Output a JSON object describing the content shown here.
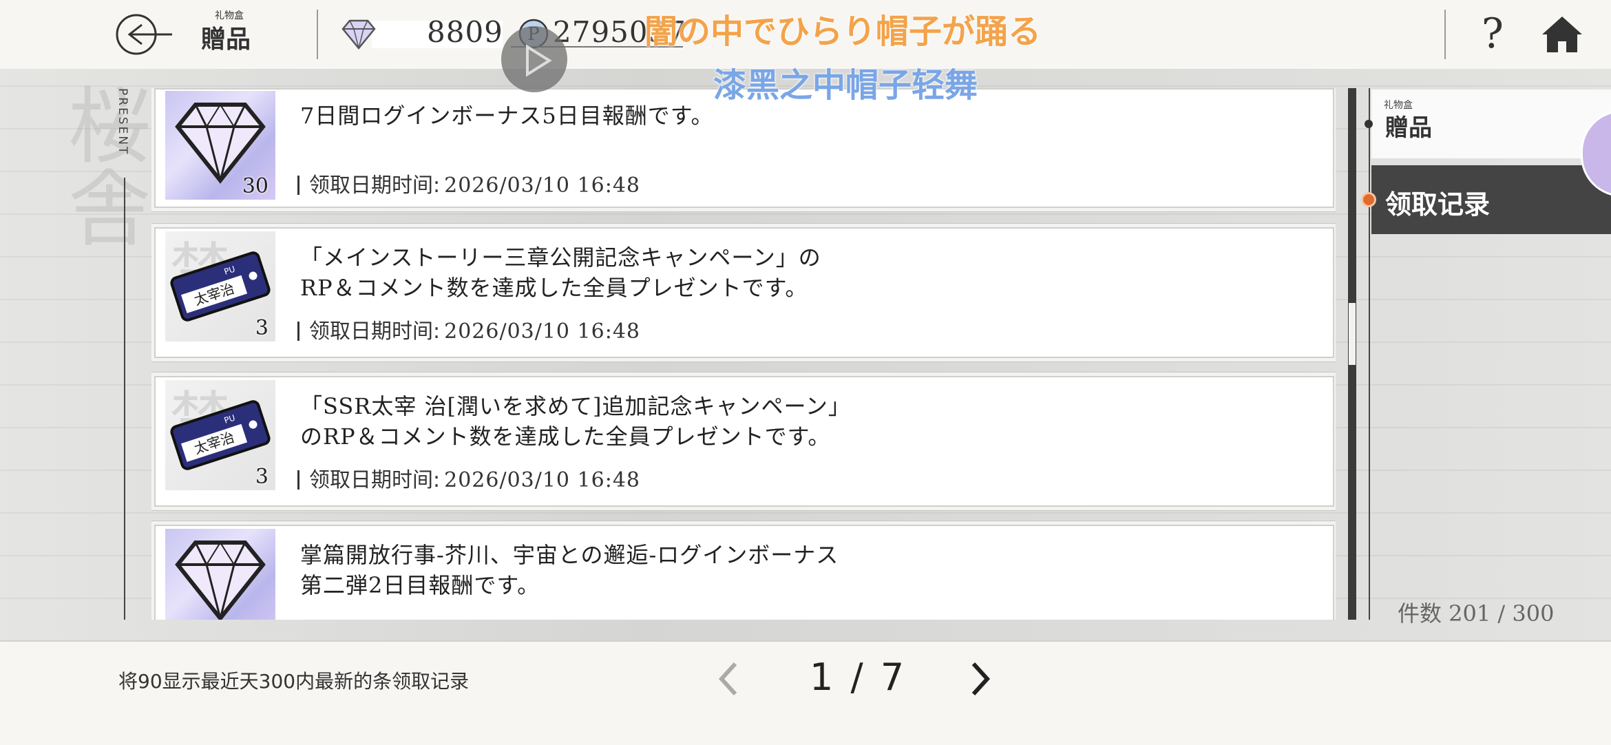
{
  "header": {
    "title_small": "礼物盒",
    "title": "贈品",
    "gem_count": "8809",
    "points_count": "2795037"
  },
  "overlay": {
    "lyric_jp": "闇の中でひらり帽子が踊る",
    "lyric_cn": "漆黑之中帽子轻舞"
  },
  "sidebar": {
    "present_label": "PRESENT",
    "bg_kanji": "桜舎"
  },
  "items": [
    {
      "icon": "diamond-gem-icon",
      "quantity": "30",
      "text": "7日間ログインボーナス5日目報酬です。",
      "date_label": "领取日期时间:",
      "date_value": "2026/03/10 16:48"
    },
    {
      "icon": "pickup-ticket-icon",
      "quantity": "3",
      "ticket_name": "太宰治",
      "text": "「メインストーリー三章公開記念キャンペーン」の\nRP＆コメント数を達成した全員プレゼントです。",
      "date_label": "领取日期时间:",
      "date_value": "2026/03/10 16:48"
    },
    {
      "icon": "pickup-ticket-icon",
      "quantity": "3",
      "ticket_name": "太宰治",
      "text": "「SSR太宰 治[潤いを求めて]追加記念キャンペーン」\nのRP＆コメント数を達成した全員プレゼントです。",
      "date_label": "领取日期时间:",
      "date_value": "2026/03/10 16:48"
    },
    {
      "icon": "diamond-gem-icon",
      "quantity": "",
      "text": "掌篇開放行事-芥川、宇宙との邂逅-ログインボーナス\n第二弾2日目報酬です。",
      "date_label": "",
      "date_value": ""
    }
  ],
  "tabs": {
    "gift_small": "礼物盒",
    "gift": "贈品",
    "history": "领取记录"
  },
  "count_label": "件数 201 / 300",
  "footer": {
    "note": "将90显示最近天300内最新的条领取记录",
    "page": "1 / 7"
  },
  "colors": {
    "accent_orange": "#e36a2c",
    "lyric_jp": "#f3a34a",
    "lyric_cn": "#7aa6e6",
    "active_tab_bg": "#444444"
  }
}
